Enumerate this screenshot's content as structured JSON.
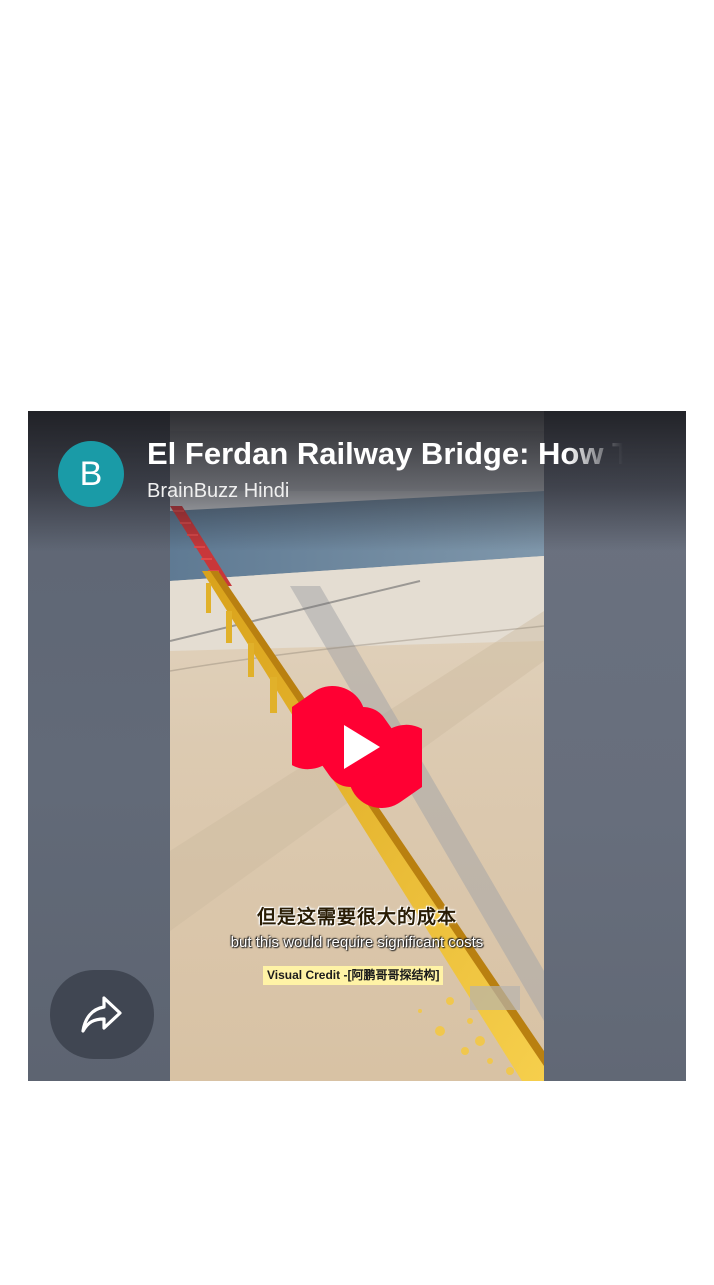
{
  "video": {
    "title": "El Ferdan Railway Bridge: How The",
    "channel_name": "BrainBuzz Hindi",
    "avatar_letter": "B",
    "avatar_color": "#1a9ba7",
    "caption_chinese": "但是这需要很大的成本",
    "caption_english": "but this would require significant costs",
    "credit_text": "Visual Credit -[阿鹏哥哥探结构]",
    "play_icon": "youtube-shorts-play-icon",
    "play_icon_color": "#ff0033"
  },
  "controls": {
    "share_icon": "share-arrow-icon"
  }
}
